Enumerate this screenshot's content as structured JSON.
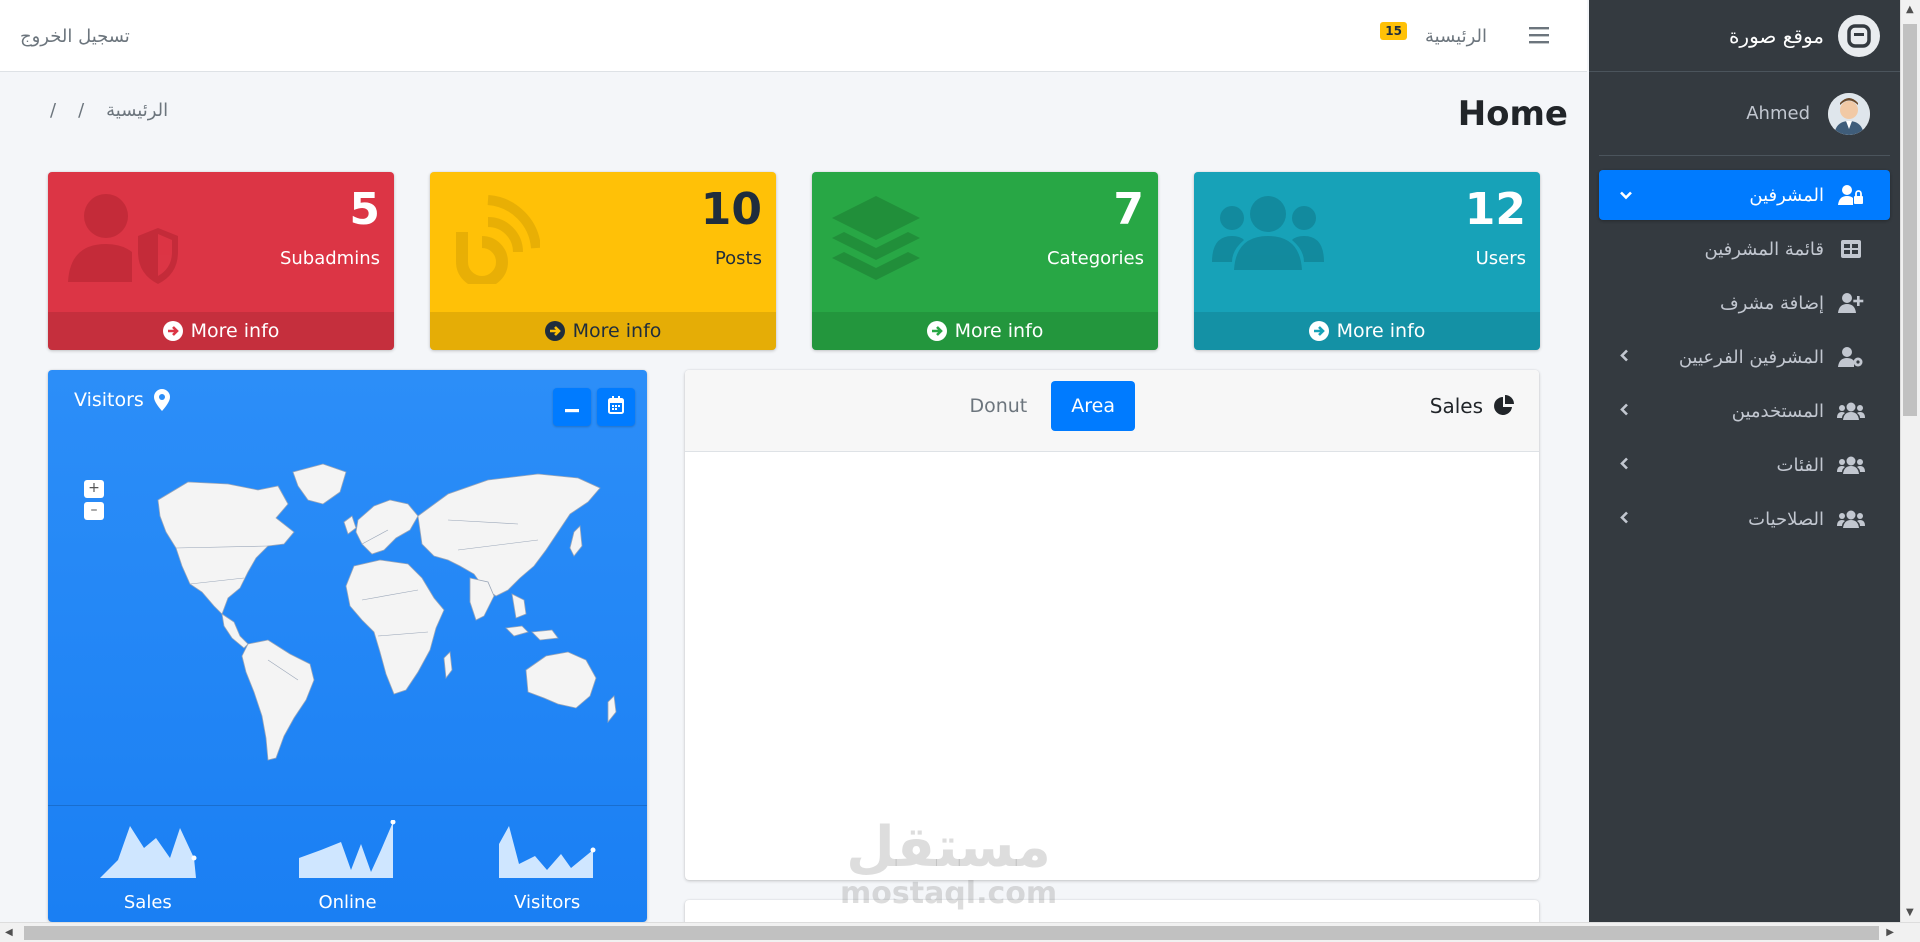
{
  "sidebar": {
    "brand": "موقع صورة",
    "user": "Ahmed",
    "items": [
      {
        "label": "المشرفين",
        "icon": "user-lock-icon",
        "active": true,
        "chevron": "down"
      },
      {
        "label": "قائمة المشرفين",
        "icon": "table-icon",
        "sub": true
      },
      {
        "label": "إضافة مشرف",
        "icon": "user-plus-icon",
        "sub": true
      },
      {
        "label": "المشرفين الفرعيين",
        "icon": "user-cog-icon",
        "chevron": "left"
      },
      {
        "label": "المستخدمين",
        "icon": "users-icon",
        "chevron": "left"
      },
      {
        "label": "الفئات",
        "icon": "users-icon",
        "chevron": "left"
      },
      {
        "label": "الصلاحيات",
        "icon": "users-icon",
        "chevron": "left"
      }
    ]
  },
  "navbar": {
    "logout": "تسجيل الخروج",
    "home": "الرئيسية",
    "badge": "15"
  },
  "header": {
    "title": "Home",
    "breadcrumb_home": "الرئيسية",
    "sep1": "/",
    "sep2": "/"
  },
  "boxes": [
    {
      "value": "5",
      "label": "Subadmins",
      "footer": "More info",
      "color": "#dc3545",
      "icon": "user-shield-icon"
    },
    {
      "value": "10",
      "label": "Posts",
      "footer": "More info",
      "color": "#ffc107",
      "icon": "blog-icon"
    },
    {
      "value": "7",
      "label": "Categories",
      "footer": "More info",
      "color": "#28a745",
      "icon": "layer-group-icon"
    },
    {
      "value": "12",
      "label": "Users",
      "footer": "More info",
      "color": "#17a2b8",
      "icon": "users-icon"
    }
  ],
  "visitors": {
    "title": "Visitors",
    "zoom_in": "+",
    "zoom_out": "–",
    "sparks": [
      {
        "label": "Sales"
      },
      {
        "label": "Online"
      },
      {
        "label": "Visitors"
      }
    ]
  },
  "sales": {
    "title": "Sales",
    "tabs": [
      {
        "label": "Donut",
        "active": false
      },
      {
        "label": "Area",
        "active": true
      }
    ]
  },
  "watermark": {
    "ar": "مستقل",
    "en": "mostaql.com"
  },
  "colors": {
    "primary": "#007bff",
    "sidebar": "#343a40",
    "danger": "#dc3545",
    "warning": "#ffc107",
    "success": "#28a745",
    "info": "#17a2b8"
  }
}
